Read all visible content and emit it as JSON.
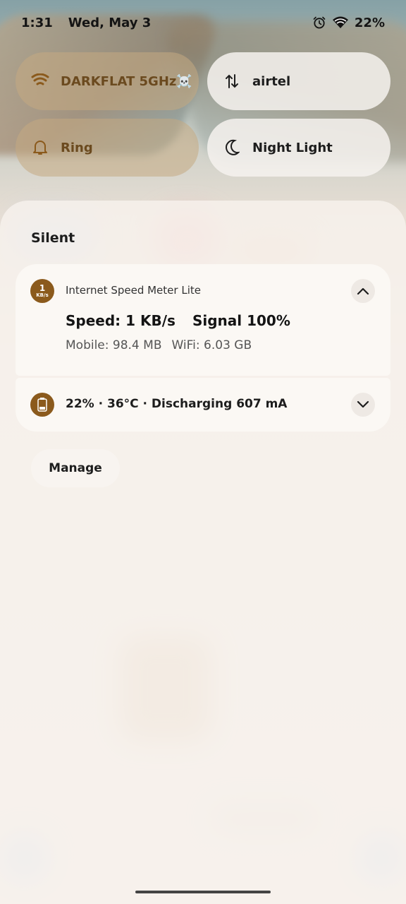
{
  "status_bar": {
    "time": "1:31",
    "date": "Wed, May 3",
    "battery": "22%",
    "icons": [
      "alarm-icon",
      "wifi-icon"
    ]
  },
  "quick_tiles": [
    {
      "label": "DARKFLAT 5GHz☠️",
      "icon": "wifi-icon",
      "state": "active"
    },
    {
      "label": "airtel",
      "icon": "mobile-data-arrows-icon",
      "state": "inactive"
    },
    {
      "label": "Ring",
      "icon": "bell-icon",
      "state": "active"
    },
    {
      "label": "Night Light",
      "icon": "moon-icon",
      "state": "inactive"
    }
  ],
  "notifications": {
    "section_title": "Silent",
    "speed_meter": {
      "icon_number": "1",
      "icon_unit": "KB/s",
      "app_name": "Internet Speed Meter Lite",
      "speed": "Speed: 1 KB/s",
      "signal": "Signal 100%",
      "mobile": "Mobile: 98.4 MB",
      "wifi": "WiFi: 6.03 GB"
    },
    "battery": {
      "text": "22% · 36°C · Discharging 607 mA",
      "icon": "battery-icon"
    },
    "manage_label": "Manage"
  },
  "colors": {
    "accent": "#8b5a1c",
    "active_tile_text": "#6b4a1f",
    "panel_bg": "#f7f2ed"
  }
}
